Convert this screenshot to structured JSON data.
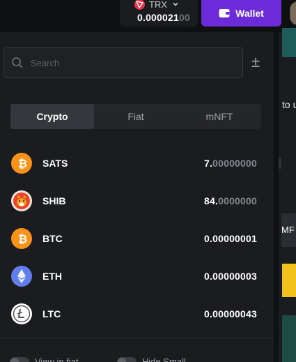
{
  "header": {
    "currency": "TRX",
    "balance_main": "0.000021",
    "balance_dim": "00",
    "wallet_label": "Wallet"
  },
  "search": {
    "placeholder": "Search"
  },
  "tabs": [
    {
      "label": "Crypto",
      "active": true
    },
    {
      "label": "Fiat",
      "active": false
    },
    {
      "label": "mNFT",
      "active": false
    }
  ],
  "coins": [
    {
      "symbol": "SATS",
      "amount_main": "7.",
      "amount_dim": "00000000",
      "icon": "bitcoin-icon",
      "color": "#f7931a"
    },
    {
      "symbol": "SHIB",
      "amount_main": "84.",
      "amount_dim": "0000000",
      "icon": "shib-icon",
      "color": "#e8432a"
    },
    {
      "symbol": "BTC",
      "amount_main": "0.00000001",
      "amount_dim": "",
      "icon": "bitcoin-icon",
      "color": "#f7931a"
    },
    {
      "symbol": "ETH",
      "amount_main": "0.00000003",
      "amount_dim": "",
      "icon": "ethereum-icon",
      "color": "#627eea"
    },
    {
      "symbol": "LTC",
      "amount_main": "0.00000043",
      "amount_dim": "",
      "icon": "litecoin-icon",
      "color": "#ffffff"
    }
  ],
  "footer": {
    "view_in_fiat": "View in fiat",
    "hide_small": "Hide Small"
  },
  "background": {
    "side_text": "to u",
    "side_button": "MF"
  },
  "colors": {
    "accent": "#6c2bd9",
    "panel": "#1a1c1f",
    "page": "#0f1012"
  }
}
